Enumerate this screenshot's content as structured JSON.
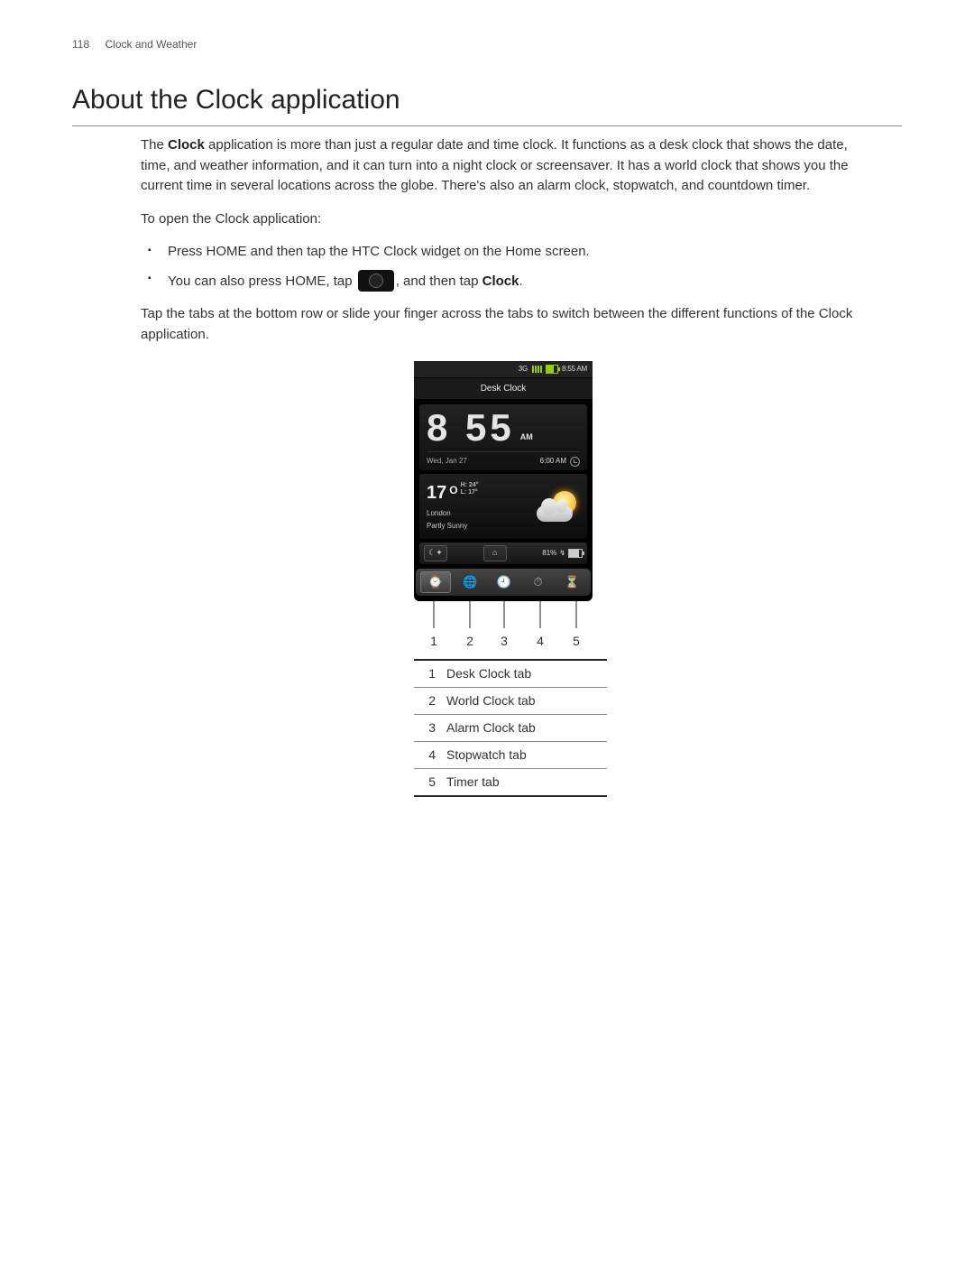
{
  "header": {
    "page_number": "118",
    "section": "Clock and Weather"
  },
  "title": "About the Clock application",
  "para1_pre": "The ",
  "para1_bold": "Clock",
  "para1_post": " application is more than just a regular date and time clock. It functions as a desk clock that shows the date, time, and weather information, and it can turn into a night clock or screensaver. It has a world clock that shows you the current time in several locations across the globe. There's also an alarm clock, stopwatch, and countdown timer.",
  "para2": "To open the Clock application:",
  "bullet1": "Press HOME and then tap the HTC Clock widget on the Home screen.",
  "bullet2_pre": "You can also press HOME, tap ",
  "bullet2_mid": ", and then tap ",
  "bullet2_bold": "Clock",
  "bullet2_post": ".",
  "para3": "Tap the tabs at the bottom row or slide your finger across the tabs to switch between the different functions of the Clock application.",
  "phone": {
    "status": {
      "net": "3G",
      "time": "8:55 AM"
    },
    "titlebar": "Desk Clock",
    "clock": {
      "time": "8 55",
      "ampm": "AM",
      "date": "Wed, Jan 27",
      "alarm_time": "6:00 AM"
    },
    "weather": {
      "temp": "17",
      "deg": "O",
      "hi": "H: 24°",
      "lo": "L: 17°",
      "location": "London",
      "condition": "Partly Sunny"
    },
    "controls": {
      "dimmer_glyph": "☾✦",
      "dock_glyph": "⌂",
      "battery": "81%",
      "charge_glyph": "↯"
    },
    "tabs_glyphs": [
      "⌚",
      "🌐",
      "🕘",
      "⏱",
      "⏳"
    ]
  },
  "callout_numbers": [
    "1",
    "2",
    "3",
    "4",
    "5"
  ],
  "legend": [
    {
      "n": "1",
      "t": "Desk Clock tab"
    },
    {
      "n": "2",
      "t": "World Clock tab"
    },
    {
      "n": "3",
      "t": "Alarm Clock tab"
    },
    {
      "n": "4",
      "t": "Stopwatch tab"
    },
    {
      "n": "5",
      "t": "Timer tab"
    }
  ]
}
